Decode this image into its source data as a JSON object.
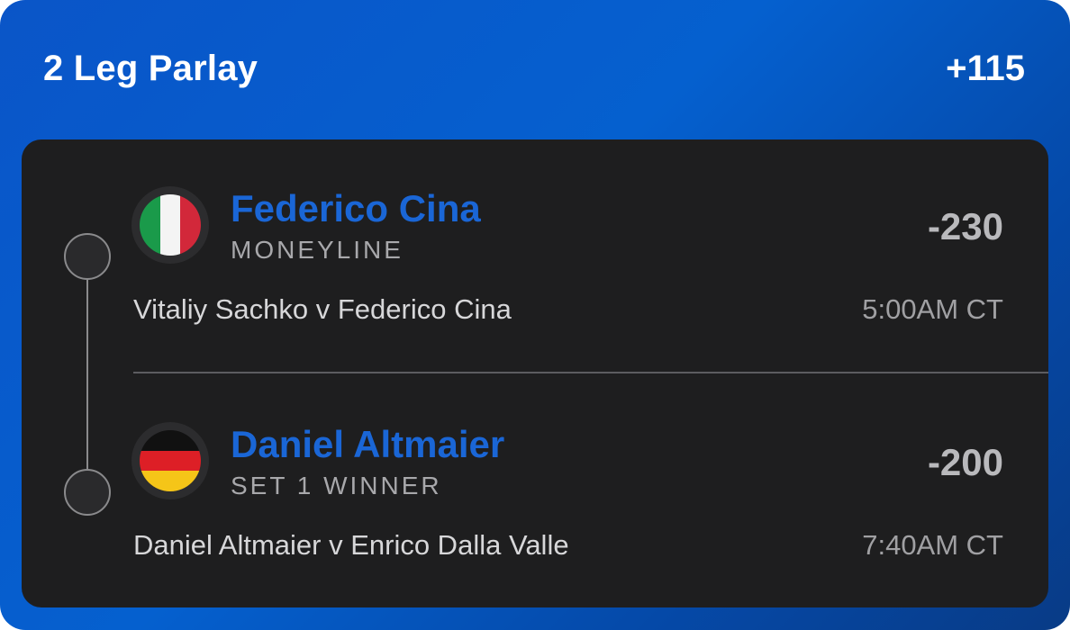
{
  "parlay": {
    "title": "2 Leg Parlay",
    "odds": "+115"
  },
  "legs": [
    {
      "player": "Federico Cina",
      "market": "MONEYLINE",
      "odds": "-230",
      "matchup": "Vitaliy Sachko v Federico Cina",
      "time": "5:00AM CT",
      "flag": "italy-flag-icon"
    },
    {
      "player": "Daniel Altmaier",
      "market": "SET 1 WINNER",
      "odds": "-200",
      "matchup": "Daniel Altmaier v Enrico Dalla Valle",
      "time": "7:40AM CT",
      "flag": "germany-flag-icon"
    }
  ],
  "colors": {
    "card_blue": "#0560cf",
    "panel_dark": "#1e1e1f",
    "player_name_blue": "#1a66d6",
    "odds_gray": "#b9b9bc"
  }
}
